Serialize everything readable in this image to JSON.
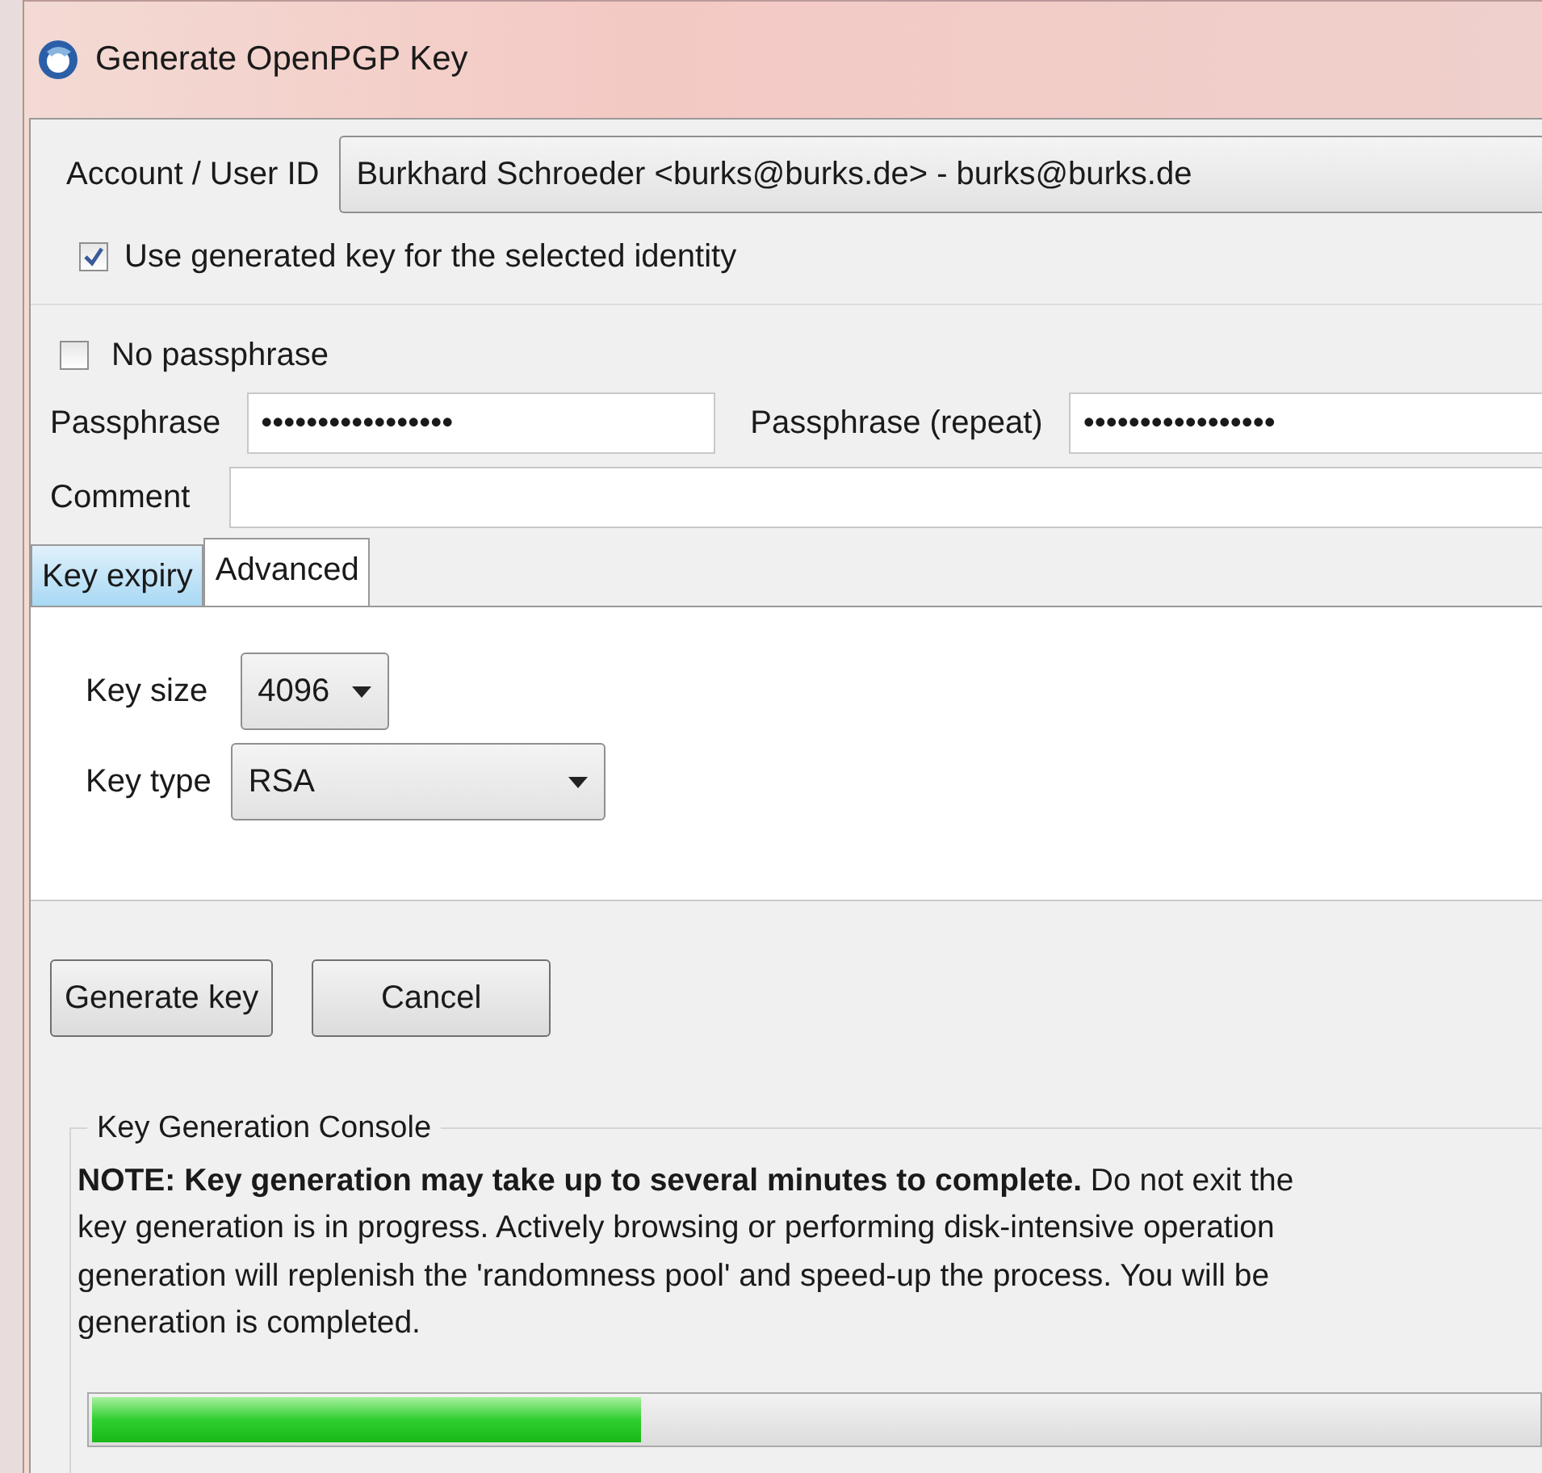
{
  "window": {
    "title": "Generate OpenPGP Key"
  },
  "account": {
    "label": "Account / User ID",
    "value": "Burkhard Schroeder <burks@burks.de> - burks@burks.de"
  },
  "use_generated": {
    "label": "Use generated key for the selected identity",
    "checked": true
  },
  "no_passphrase": {
    "label": "No passphrase",
    "checked": false
  },
  "passphrase": {
    "label": "Passphrase",
    "value": "•••••••••••••••••"
  },
  "passphrase_repeat": {
    "label": "Passphrase (repeat)",
    "value": "•••••••••••••••••"
  },
  "comment": {
    "label": "Comment"
  },
  "tabs": [
    {
      "label": "Key expiry",
      "selected": false,
      "hover": true
    },
    {
      "label": "Advanced",
      "selected": true,
      "hover": false
    }
  ],
  "key_size": {
    "label": "Key size",
    "value": "4096"
  },
  "key_type": {
    "label": "Key type",
    "value": "RSA"
  },
  "buttons": [
    "Generate key",
    "Cancel"
  ],
  "console": {
    "title": "Key Generation Console",
    "lines": [
      "**NOTE: Key generation may take up to several minutes to complete.** Do not exit the",
      "key generation is in progress. Actively browsing or performing disk-intensive operation",
      "generation will replenish the 'randomness pool' and speed-up the process. You will be",
      "generation is completed."
    ],
    "progress": {
      "level": 0.38
    }
  }
}
